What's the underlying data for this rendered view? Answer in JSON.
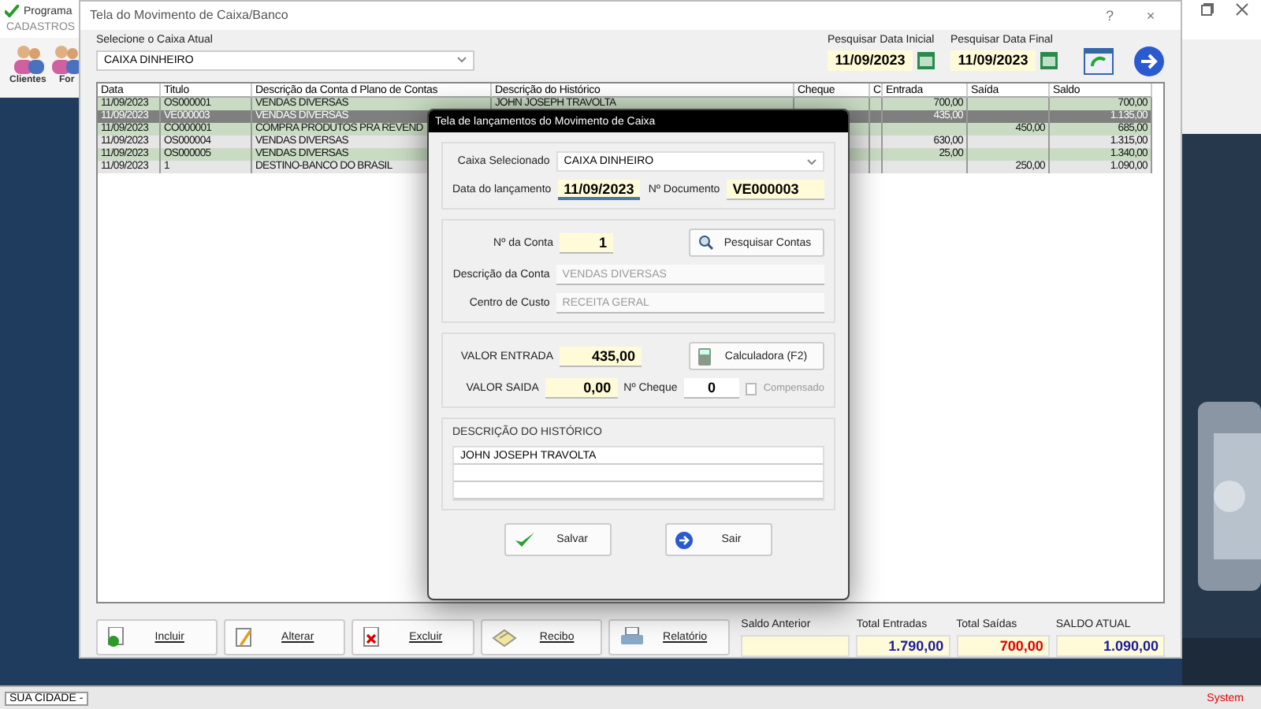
{
  "app": {
    "title": "Programa",
    "menu": [
      "CADASTROS"
    ],
    "toolbar": [
      "Clientes",
      "For"
    ]
  },
  "window": {
    "title": "Tela do Movimento de Caixa/Banco",
    "help": "?",
    "close": "×"
  },
  "caixa": {
    "label": "Selecione o Caixa Atual",
    "value": "CAIXA DINHEIRO"
  },
  "date_start": {
    "label": "Pesquisar Data Inicial",
    "value": "11/09/2023"
  },
  "date_end": {
    "label": "Pesquisar Data Final",
    "value": "11/09/2023"
  },
  "table": {
    "columns": [
      "Data",
      "Titulo",
      "Descrição da Conta d Plano de Contas",
      "Descrição do Histórico",
      "Cheque",
      "C",
      "Entrada",
      "Saída",
      "Saldo"
    ],
    "rows": [
      {
        "date": "11/09/2023",
        "title": "OS000001",
        "account": "VENDAS DIVERSAS",
        "history": "JOHN JOSEPH TRAVOLTA",
        "entrada": "700,00",
        "saldo": "700,00",
        "selected": false
      },
      {
        "date": "11/09/2023",
        "title": "VE000003",
        "account": "VENDAS DIVERSAS",
        "entrada": "435,00",
        "saldo": "1.135,00",
        "selected": true
      },
      {
        "date": "11/09/2023",
        "title": "CO000001",
        "account": "COMPRA PRODUTOS PRA REVEND",
        "saida": "450,00",
        "saldo": "685,00",
        "selected": false
      },
      {
        "date": "11/09/2023",
        "title": "OS000004",
        "account": "VENDAS DIVERSAS",
        "entrada": "630,00",
        "saldo": "1.315,00",
        "selected": false
      },
      {
        "date": "11/09/2023",
        "title": "OS000005",
        "account": "VENDAS DIVERSAS",
        "entrada": "25,00",
        "saldo": "1.340,00",
        "selected": false
      },
      {
        "date": "11/09/2023",
        "title": "1",
        "account": "DESTINO-BANCO DO BRASIL",
        "saida": "250,00",
        "saldo": "1.090,00",
        "selected": false
      }
    ]
  },
  "buttons": [
    {
      "label": "Incluir",
      "kind": "add"
    },
    {
      "label": "Alterar",
      "kind": "edit"
    },
    {
      "label": "Excluir",
      "kind": "delete"
    },
    {
      "label": "Recibo",
      "kind": "receipt"
    },
    {
      "label": "Relatório",
      "kind": "print"
    }
  ],
  "totals": [
    {
      "label": "Saldo Anterior"
    },
    {
      "label": "Total Entradas",
      "value": "1.790,00",
      "color": "#1a1aa0"
    },
    {
      "label": "Total Saídas",
      "value": "700,00",
      "color": "#e00000"
    },
    {
      "label": "SALDO ATUAL",
      "value": "1.090,00",
      "color": "#1a1aa0"
    }
  ],
  "dialog": {
    "title": "Tela de lançamentos do Movimento de Caixa",
    "caixa_label": "Caixa Selecionado",
    "caixa_value": "CAIXA DINHEIRO",
    "date_label": "Data do lançamento",
    "date_value": "11/09/2023",
    "doc_label": "Nº Documento",
    "doc_value": "VE000003",
    "conta_label": "Nº da Conta",
    "conta_value": "1",
    "search_button": "Pesquisar Contas",
    "desc_label": "Descrição da Conta",
    "desc_value": "VENDAS DIVERSAS",
    "centro_label": "Centro de Custo",
    "centro_value": "RECEITA GERAL",
    "entrada_label": "VALOR ENTRADA",
    "entrada_value": "435,00",
    "calc_button": "Calculadora  (F2)",
    "saida_label": "VALOR SAIDA",
    "saida_value": "0,00",
    "cheque_label": "Nº Cheque",
    "cheque_value": "0",
    "compensado": {
      "label": "Compensado",
      "checked": false
    },
    "historico_label": "DESCRIÇÃO DO HISTÓRICO",
    "historico_lines": [
      "JOHN JOSEPH TRAVOLTA"
    ],
    "buttons": [
      {
        "label": "Salvar",
        "kind": "save"
      },
      {
        "label": "Sair",
        "kind": "exit"
      }
    ]
  },
  "status_bar": {
    "city": "SUA CIDADE -",
    "system": "System"
  }
}
